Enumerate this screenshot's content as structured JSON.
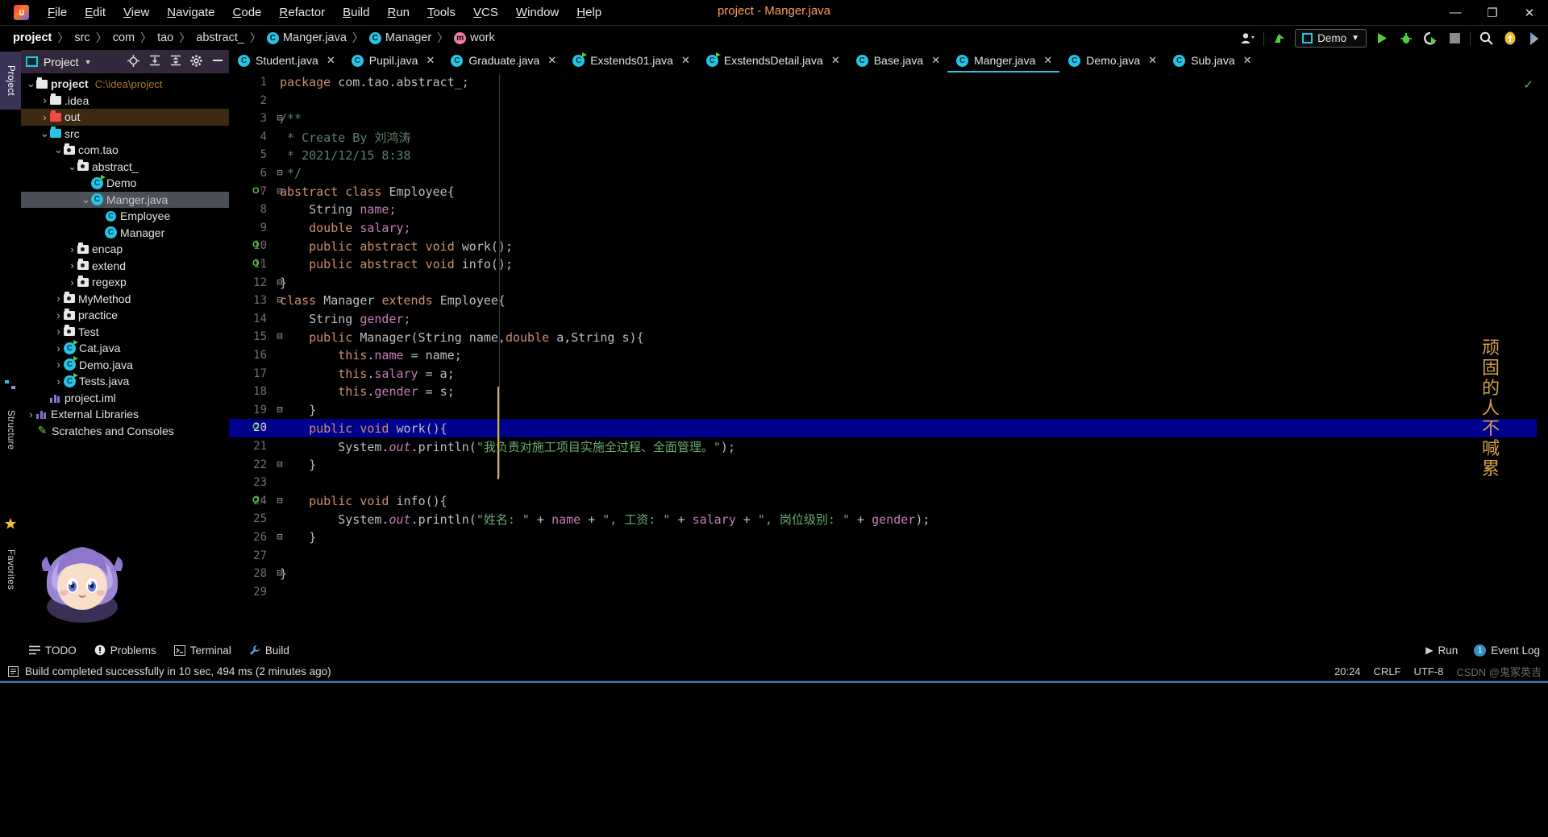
{
  "window": {
    "title": "project - Manger.java",
    "minimize": "—",
    "restore": "❐",
    "close": "✕",
    "logo_text": "IJ"
  },
  "menu": {
    "items": [
      "File",
      "Edit",
      "View",
      "Navigate",
      "Code",
      "Refactor",
      "Build",
      "Run",
      "Tools",
      "VCS",
      "Window",
      "Help"
    ]
  },
  "breadcrumb": {
    "separator": "〉",
    "items": [
      {
        "label": "project",
        "icon": "",
        "bold": true
      },
      {
        "label": "src",
        "icon": ""
      },
      {
        "label": "com",
        "icon": ""
      },
      {
        "label": "tao",
        "icon": ""
      },
      {
        "label": "abstract_",
        "icon": ""
      },
      {
        "label": "Manger.java",
        "icon": "C"
      },
      {
        "label": "Manager",
        "icon": "C"
      },
      {
        "label": "work",
        "icon": "m"
      }
    ]
  },
  "toolbar_right": {
    "account_icon": "account-icon",
    "updates_icon": "update-arrow-icon",
    "run_config": "Demo",
    "run_icon": "▶",
    "debug_icon": "debug-bug-icon",
    "coverage_icon": "coverage-icon",
    "stop_icon": "■",
    "search_icon": "⌕",
    "notification_icon": "notification-icon",
    "ide_icon": "ide-icon"
  },
  "left_strip": {
    "project": "Project",
    "structure": "Structure",
    "favorites": "Favorites"
  },
  "project_panel": {
    "title": "Project",
    "chevron": "▾",
    "icons": [
      "locate-icon",
      "expand-all-icon",
      "collapse-all-icon",
      "settings-gear-icon",
      "hide-icon"
    ],
    "tree": [
      {
        "depth": 0,
        "arrow": "⌄",
        "icon": "folder-module",
        "label": "project",
        "bold": true,
        "path": "C:\\idea\\project"
      },
      {
        "depth": 1,
        "arrow": "›",
        "icon": "folder-white",
        "label": ".idea"
      },
      {
        "depth": 1,
        "arrow": "›",
        "icon": "folder-red",
        "label": "out",
        "row": "out"
      },
      {
        "depth": 1,
        "arrow": "⌄",
        "icon": "folder-cyan",
        "label": "src"
      },
      {
        "depth": 2,
        "arrow": "⌄",
        "icon": "package",
        "label": "com.tao"
      },
      {
        "depth": 3,
        "arrow": "⌄",
        "icon": "package",
        "label": "abstract_"
      },
      {
        "depth": 4,
        "arrow": "",
        "icon": "class-run",
        "label": "Demo"
      },
      {
        "depth": 4,
        "arrow": "⌄",
        "icon": "class",
        "label": "Manger.java",
        "selected": true
      },
      {
        "depth": 5,
        "arrow": "",
        "icon": "interface",
        "label": "Employee"
      },
      {
        "depth": 5,
        "arrow": "",
        "icon": "class",
        "label": "Manager"
      },
      {
        "depth": 3,
        "arrow": "›",
        "icon": "package",
        "label": "encap"
      },
      {
        "depth": 3,
        "arrow": "›",
        "icon": "package",
        "label": "extend"
      },
      {
        "depth": 3,
        "arrow": "›",
        "icon": "package",
        "label": "regexp"
      },
      {
        "depth": 2,
        "arrow": "›",
        "icon": "package",
        "label": "MyMethod"
      },
      {
        "depth": 2,
        "arrow": "›",
        "icon": "package",
        "label": "practice"
      },
      {
        "depth": 2,
        "arrow": "›",
        "icon": "package",
        "label": "Test"
      },
      {
        "depth": 2,
        "arrow": "›",
        "icon": "class-run",
        "label": "Cat.java"
      },
      {
        "depth": 2,
        "arrow": "›",
        "icon": "class-run",
        "label": "Demo.java"
      },
      {
        "depth": 2,
        "arrow": "›",
        "icon": "class-run",
        "label": "Tests.java"
      },
      {
        "depth": 1,
        "arrow": "",
        "icon": "iml",
        "label": "project.iml"
      },
      {
        "depth": 0,
        "arrow": "›",
        "icon": "libraries",
        "label": "External Libraries"
      },
      {
        "depth": 0,
        "arrow": "",
        "icon": "scratches",
        "label": "Scratches and Consoles"
      }
    ]
  },
  "editor_tabs": [
    {
      "label": "Student.java",
      "icon": "class",
      "active": false
    },
    {
      "label": "Pupil.java",
      "icon": "class",
      "active": false
    },
    {
      "label": "Graduate.java",
      "icon": "class",
      "active": false
    },
    {
      "label": "Exstends01.java",
      "icon": "class-run",
      "active": false
    },
    {
      "label": "ExstendsDetail.java",
      "icon": "class-run",
      "active": false
    },
    {
      "label": "Base.java",
      "icon": "class",
      "active": false
    },
    {
      "label": "Manger.java",
      "icon": "class",
      "active": true
    },
    {
      "label": "Demo.java",
      "icon": "class",
      "active": false
    },
    {
      "label": "Sub.java",
      "icon": "class",
      "active": false
    }
  ],
  "tab_close": "✕",
  "editor": {
    "inspection_ok": "✓",
    "watermark": "顽固的人不喊累",
    "lines": [
      {
        "n": 1,
        "segments": [
          {
            "t": "package ",
            "c": "kw"
          },
          {
            "t": "com.tao.abstract_;",
            "c": "id"
          }
        ]
      },
      {
        "n": 2,
        "segments": []
      },
      {
        "n": 3,
        "fold": "⊟",
        "segments": [
          {
            "t": "/**",
            "c": "cmt"
          }
        ]
      },
      {
        "n": 4,
        "segments": [
          {
            "t": " * Create By 刘鸿涛",
            "c": "cmt"
          }
        ]
      },
      {
        "n": 5,
        "segments": [
          {
            "t": " * 2021/12/15 8:38",
            "c": "cmt"
          }
        ]
      },
      {
        "n": 6,
        "fold": "⊟",
        "segments": [
          {
            "t": " */",
            "c": "cmt"
          }
        ]
      },
      {
        "n": 7,
        "gmark": "O",
        "fold": "⊟",
        "segments": [
          {
            "t": "abstract ",
            "c": "kw"
          },
          {
            "t": "class ",
            "c": "kw"
          },
          {
            "t": "Employee{",
            "c": "id"
          }
        ]
      },
      {
        "n": 8,
        "segments": [
          {
            "t": "    String ",
            "c": "id"
          },
          {
            "t": "name;",
            "c": "fld"
          }
        ]
      },
      {
        "n": 9,
        "segments": [
          {
            "t": "    ",
            "c": "id"
          },
          {
            "t": "double ",
            "c": "kw"
          },
          {
            "t": "salary;",
            "c": "fld"
          }
        ]
      },
      {
        "n": 10,
        "gmark": "O",
        "segments": [
          {
            "t": "    ",
            "c": "id"
          },
          {
            "t": "public abstract void ",
            "c": "kw"
          },
          {
            "t": "work();",
            "c": "id"
          }
        ]
      },
      {
        "n": 11,
        "gmark": "O",
        "segments": [
          {
            "t": "    ",
            "c": "id"
          },
          {
            "t": "public abstract void ",
            "c": "kw"
          },
          {
            "t": "info();",
            "c": "id"
          }
        ]
      },
      {
        "n": 12,
        "fold": "⊟",
        "segments": [
          {
            "t": "}",
            "c": "id"
          }
        ]
      },
      {
        "n": 13,
        "fold": "⊟",
        "segments": [
          {
            "t": "class ",
            "c": "kw"
          },
          {
            "t": "Manager ",
            "c": "id"
          },
          {
            "t": "extends ",
            "c": "kw"
          },
          {
            "t": "Employee{",
            "c": "id"
          }
        ]
      },
      {
        "n": 14,
        "segments": [
          {
            "t": "    String ",
            "c": "id"
          },
          {
            "t": "gender;",
            "c": "fld"
          }
        ]
      },
      {
        "n": 15,
        "fold": "⊟",
        "segments": [
          {
            "t": "    ",
            "c": "id"
          },
          {
            "t": "public ",
            "c": "kw"
          },
          {
            "t": "Manager(String name,",
            "c": "id"
          },
          {
            "t": "double ",
            "c": "kw"
          },
          {
            "t": "a,String s){",
            "c": "id"
          }
        ]
      },
      {
        "n": 16,
        "segments": [
          {
            "t": "        ",
            "c": "id"
          },
          {
            "t": "this",
            "c": "kw"
          },
          {
            "t": ".",
            "c": "id"
          },
          {
            "t": "name ",
            "c": "fld"
          },
          {
            "t": "= name;",
            "c": "id"
          }
        ]
      },
      {
        "n": 17,
        "segments": [
          {
            "t": "        ",
            "c": "id"
          },
          {
            "t": "this",
            "c": "kw"
          },
          {
            "t": ".",
            "c": "id"
          },
          {
            "t": "salary ",
            "c": "fld"
          },
          {
            "t": "= a;",
            "c": "id"
          }
        ]
      },
      {
        "n": 18,
        "segments": [
          {
            "t": "        ",
            "c": "id"
          },
          {
            "t": "this",
            "c": "kw"
          },
          {
            "t": ".",
            "c": "id"
          },
          {
            "t": "gender ",
            "c": "fld"
          },
          {
            "t": "= s;",
            "c": "id"
          }
        ]
      },
      {
        "n": 19,
        "fold": "⊟",
        "segments": [
          {
            "t": "    }",
            "c": "id"
          }
        ]
      },
      {
        "n": 20,
        "gmark": "O",
        "fold": "⊟",
        "highlight": true,
        "segments": [
          {
            "t": "    ",
            "c": "id"
          },
          {
            "t": "public void ",
            "c": "kw"
          },
          {
            "t": "work(){",
            "c": "id"
          }
        ]
      },
      {
        "n": 21,
        "segments": [
          {
            "t": "        System.",
            "c": "id"
          },
          {
            "t": "out",
            "c": "stat"
          },
          {
            "t": ".println(",
            "c": "id"
          },
          {
            "t": "\"我负责对施工项目实施全过程、全面管理。\"",
            "c": "str"
          },
          {
            "t": ");",
            "c": "id"
          }
        ]
      },
      {
        "n": 22,
        "fold": "⊟",
        "segments": [
          {
            "t": "    }",
            "c": "id"
          }
        ]
      },
      {
        "n": 23,
        "segments": []
      },
      {
        "n": 24,
        "gmark": "O",
        "fold": "⊟",
        "segments": [
          {
            "t": "    ",
            "c": "id"
          },
          {
            "t": "public void ",
            "c": "kw"
          },
          {
            "t": "info(){",
            "c": "id"
          }
        ]
      },
      {
        "n": 25,
        "segments": [
          {
            "t": "        System.",
            "c": "id"
          },
          {
            "t": "out",
            "c": "stat"
          },
          {
            "t": ".println(",
            "c": "id"
          },
          {
            "t": "\"姓名: \"",
            "c": "str"
          },
          {
            "t": " + ",
            "c": "id"
          },
          {
            "t": "name",
            "c": "fld"
          },
          {
            "t": " + ",
            "c": "id"
          },
          {
            "t": "\", 工资: \"",
            "c": "str"
          },
          {
            "t": " + ",
            "c": "id"
          },
          {
            "t": "salary",
            "c": "fld"
          },
          {
            "t": " + ",
            "c": "id"
          },
          {
            "t": "\", 岗位级别: \"",
            "c": "str"
          },
          {
            "t": " + ",
            "c": "id"
          },
          {
            "t": "gender",
            "c": "fld"
          },
          {
            "t": ");",
            "c": "id"
          }
        ]
      },
      {
        "n": 26,
        "fold": "⊟",
        "segments": [
          {
            "t": "    }",
            "c": "id"
          }
        ]
      },
      {
        "n": 27,
        "segments": []
      },
      {
        "n": 28,
        "fold": "⊟",
        "segments": [
          {
            "t": "}",
            "c": "id"
          }
        ]
      },
      {
        "n": 29,
        "segments": []
      }
    ]
  },
  "bottom_bar": {
    "items": [
      {
        "label": "TODO",
        "icon": "todo-icon"
      },
      {
        "label": "Problems",
        "icon": "problems-icon"
      },
      {
        "label": "Terminal",
        "icon": "terminal-icon"
      },
      {
        "label": "Build",
        "icon": "build-icon"
      }
    ],
    "run_label": "Run",
    "run_icon": "▶",
    "event_log_label": "Event Log",
    "event_log_count": "1"
  },
  "status_bar": {
    "message": "Build completed successfully in 10 sec, 494 ms (2 minutes ago)",
    "time": "20:24",
    "line_sep": "CRLF",
    "encoding": "UTF-8",
    "watermark": "CSDN @鬼冢英吉"
  }
}
